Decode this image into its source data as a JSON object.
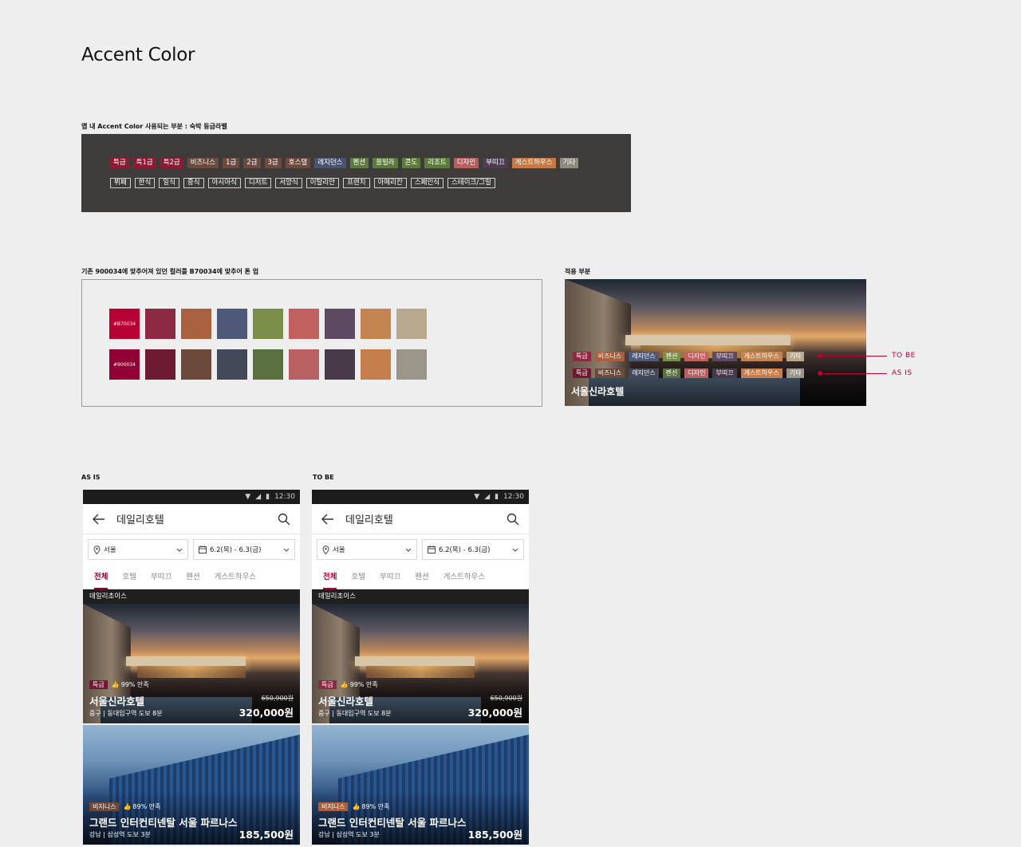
{
  "page_title": "Accent Color",
  "section1": {
    "caption": "앱 내 Accent Color 사용되는 부분 : 숙박 등급라벨",
    "grade_labels": [
      {
        "label": "특급",
        "color": "#8e1b35"
      },
      {
        "label": "특1급",
        "color": "#8e1b35"
      },
      {
        "label": "특2급",
        "color": "#8e1b35"
      },
      {
        "label": "비즈니스",
        "color": "#6b4a40"
      },
      {
        "label": "1급",
        "color": "#6b4a40"
      },
      {
        "label": "2급",
        "color": "#6b4a40"
      },
      {
        "label": "3급",
        "color": "#6b4a40"
      },
      {
        "label": "호스텔",
        "color": "#6b4a40"
      },
      {
        "label": "레지던스",
        "color": "#4a5470"
      },
      {
        "label": "펜션",
        "color": "#5e7a3e"
      },
      {
        "label": "풀빌라",
        "color": "#5e7a3e"
      },
      {
        "label": "콘도",
        "color": "#5e7a3e"
      },
      {
        "label": "리조트",
        "color": "#5e7a3e"
      },
      {
        "label": "디자인",
        "color": "#b85c5e"
      },
      {
        "label": "부띠끄",
        "color": "#4c3d52"
      },
      {
        "label": "게스트하우스",
        "color": "#c47a45"
      },
      {
        "label": "기타",
        "color": "#8e8a7e"
      }
    ],
    "food_labels": [
      "뷔페",
      "한식",
      "일식",
      "중식",
      "아시아식",
      "디저트",
      "서양식",
      "이탈리안",
      "프렌치",
      "아메리칸",
      "스페인식",
      "스테이크/그릴"
    ]
  },
  "section2": {
    "caption": "기존 900034에 맞추어져 있던 컬러를 B70034에 맞추어 톤 업",
    "row_new": {
      "label": "#B70034",
      "colors": [
        "#b70034",
        "#8b2a42",
        "#a8603f",
        "#4e5878",
        "#7c8f4a",
        "#c0605f",
        "#5c4a62",
        "#c4844f",
        "#b8a88e"
      ]
    },
    "row_old": {
      "label": "#900034",
      "colors": [
        "#900034",
        "#6e1a33",
        "#6b4a3c",
        "#44495a",
        "#5b7040",
        "#b86062",
        "#483a48",
        "#c47d4b",
        "#9a978a"
      ]
    }
  },
  "applied": {
    "caption": "적용 부분",
    "hotel_name": "서울신라호텔",
    "tobe_label": "TO BE",
    "asis_label": "AS IS",
    "tobe_tags": [
      {
        "label": "특급",
        "color": "#8b2a42"
      },
      {
        "label": "비즈니스",
        "color": "#a8603f"
      },
      {
        "label": "레지던스",
        "color": "#4e5878"
      },
      {
        "label": "펜션",
        "color": "#7c8f4a"
      },
      {
        "label": "디자인",
        "color": "#c0605f"
      },
      {
        "label": "부띠끄",
        "color": "#5c4a62"
      },
      {
        "label": "게스트하우스",
        "color": "#c4844f"
      },
      {
        "label": "기타",
        "color": "#b8a88e"
      }
    ],
    "asis_tags": [
      {
        "label": "특급",
        "color": "#6e1a33"
      },
      {
        "label": "비즈니스",
        "color": "#6b4a3c"
      },
      {
        "label": "레지던스",
        "color": "#44495a"
      },
      {
        "label": "펜션",
        "color": "#5b7040"
      },
      {
        "label": "디자인",
        "color": "#b86062"
      },
      {
        "label": "부띠끄",
        "color": "#483a48"
      },
      {
        "label": "게스트하우스",
        "color": "#c47d4b"
      },
      {
        "label": "기타",
        "color": "#9a978a"
      }
    ]
  },
  "phones": [
    {
      "caption": "AS IS",
      "accent": "#900034",
      "time": "12:30",
      "title": "데일리호텔",
      "location": "서울",
      "dates": "6.2(목) - 6.3(금)",
      "tabs": [
        "전체",
        "호텔",
        "부띠끄",
        "펜션",
        "게스트하우스"
      ],
      "section": "데일리초이스",
      "cards": [
        {
          "badge": "특급",
          "badge_color": "#6e1a33",
          "satisfaction": "99% 만족",
          "name": "서울신라호텔",
          "location": "중구 | 동대입구역 도보 8분",
          "old_price": "650,900원",
          "price": "320,000원"
        },
        {
          "badge": "비지니스",
          "badge_color": "#6b4a3c",
          "satisfaction": "89% 만족",
          "name": "그랜드 인터컨티넨탈 서울 파르나스",
          "location": "강남 | 삼성역 도보 3분",
          "old_price": "",
          "price": "185,500원"
        }
      ]
    },
    {
      "caption": "TO BE",
      "accent": "#b70034",
      "time": "12:30",
      "title": "데일리호텔",
      "location": "서울",
      "dates": "6.2(목) - 6.3(금)",
      "tabs": [
        "전체",
        "호텔",
        "부띠끄",
        "펜션",
        "게스트하우스"
      ],
      "section": "데일리초이스",
      "cards": [
        {
          "badge": "특급",
          "badge_color": "#8b2a42",
          "satisfaction": "99% 만족",
          "name": "서울신라호텔",
          "location": "중구 | 동대입구역 도보 8분",
          "old_price": "650,900원",
          "price": "320,000원"
        },
        {
          "badge": "비지니스",
          "badge_color": "#a8603f",
          "satisfaction": "89% 만족",
          "name": "그랜드 인터컨티넨탈 서울 파르나스",
          "location": "강남 | 삼성역 도보 3분",
          "old_price": "",
          "price": "185,500원"
        }
      ]
    }
  ]
}
